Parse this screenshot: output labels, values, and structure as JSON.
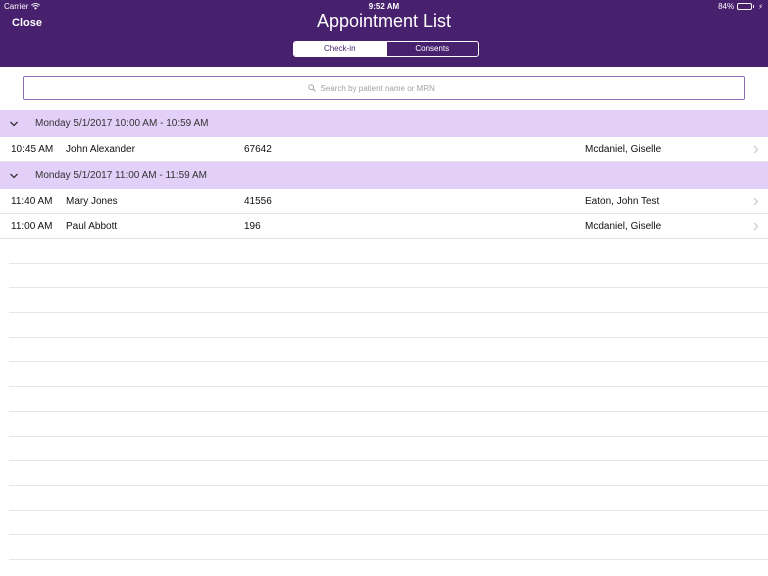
{
  "status_bar": {
    "carrier": "Carrier",
    "time": "9:52 AM",
    "battery": "84%",
    "battery_level": 0.84,
    "icons": [
      "wifi-icon",
      "battery-icon",
      "charging-icon"
    ]
  },
  "header": {
    "close_label": "Close",
    "title": "Appointment List",
    "background_color": "#47206e"
  },
  "segmented_control": {
    "segments": [
      "Check-in",
      "Consents"
    ],
    "selected": "Check-in"
  },
  "search": {
    "placeholder": "Search by patient name or MRN",
    "value": ""
  },
  "sections": [
    {
      "header": "Monday 5/1/2017 10:00 AM - 10:59 AM",
      "rows": [
        {
          "time": "10:45 AM",
          "patient": "John Alexander",
          "mrn": "67642",
          "provider": "Mcdaniel, Giselle"
        }
      ]
    },
    {
      "header": "Monday 5/1/2017 11:00 AM - 11:59 AM",
      "rows": [
        {
          "time": "11:40 AM",
          "patient": "Mary Jones",
          "mrn": "41556",
          "provider": "Eaton, John Test"
        },
        {
          "time": "11:00 AM",
          "patient": "Paul Abbott",
          "mrn": "196",
          "provider": "Mcdaniel, Giselle"
        }
      ]
    }
  ],
  "colors": {
    "accent": "#47206e",
    "section_header_bg": "#e2d0f9",
    "search_border": "#8d6ab6"
  }
}
